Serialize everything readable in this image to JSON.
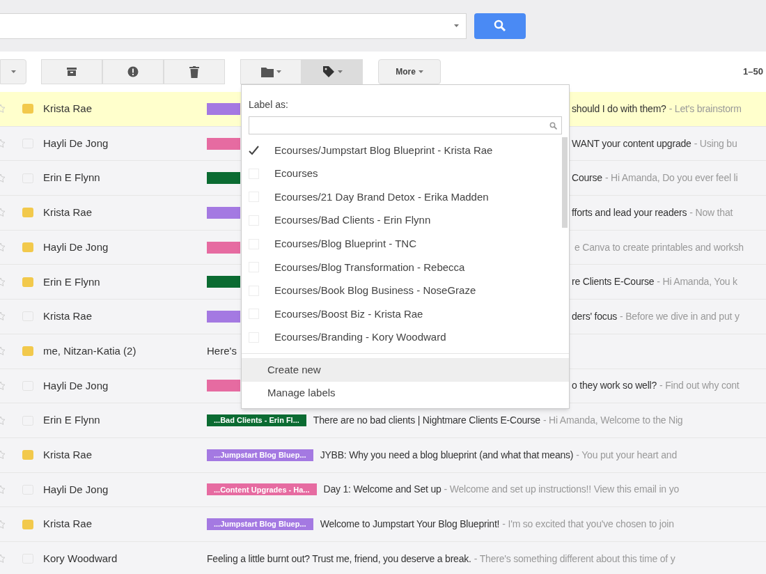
{
  "toolbar": {
    "groups": [
      {
        "buttons": [
          {
            "kind": "caret"
          }
        ]
      },
      {
        "buttons": [
          {
            "kind": "archive"
          },
          {
            "kind": "spam"
          },
          {
            "kind": "delete"
          }
        ]
      },
      {
        "buttons": [
          {
            "kind": "folder",
            "pressed": false
          },
          {
            "kind": "label",
            "pressed": true
          }
        ]
      },
      {
        "buttons": [
          {
            "kind": "more",
            "label": "More"
          }
        ]
      }
    ],
    "range": "1–50"
  },
  "label_menu": {
    "title": "Label as:",
    "items": [
      {
        "label": "Ecourses/Jumpstart Blog Blueprint - Krista Rae",
        "checked": true
      },
      {
        "label": "Ecourses",
        "checked": false
      },
      {
        "label": "Ecourses/21 Day Brand Detox - Erika Madden",
        "checked": false
      },
      {
        "label": "Ecourses/Bad Clients - Erin Flynn",
        "checked": false
      },
      {
        "label": "Ecourses/Blog Blueprint - TNC",
        "checked": false
      },
      {
        "label": "Ecourses/Blog Transformation - Rebecca",
        "checked": false
      },
      {
        "label": "Ecourses/Book Blog Business - NoseGraze",
        "checked": false
      },
      {
        "label": "Ecourses/Boost Biz - Krista Rae",
        "checked": false
      },
      {
        "label": "Ecourses/Branding - Kory Woodward",
        "checked": false
      }
    ],
    "actions": [
      {
        "label": "Create new",
        "selected": true
      },
      {
        "label": "Manage labels",
        "selected": false
      }
    ]
  },
  "rows": [
    {
      "sender": "Krista Rae",
      "important": true,
      "selected": true,
      "covered": true,
      "tag": {
        "color": "#a479e2"
      },
      "subject": "should I do with them?",
      "snippet": "- Let's brainstorm"
    },
    {
      "sender": "Hayli De Jong",
      "important": false,
      "selected": false,
      "covered": true,
      "tag": {
        "color": "#e66ba1"
      },
      "subject": "WANT your content upgrade",
      "snippet": "- Using bu"
    },
    {
      "sender": "Erin E Flynn",
      "important": false,
      "selected": false,
      "covered": true,
      "tag": {
        "color": "#0b6b32"
      },
      "subject": "Course",
      "snippet": "- Hi Amanda, Do you ever feel li"
    },
    {
      "sender": "Krista Rae",
      "important": true,
      "selected": false,
      "covered": true,
      "tag": {
        "color": "#a479e2"
      },
      "subject": "fforts and lead your readers",
      "snippet": "- Now that"
    },
    {
      "sender": "Hayli De Jong",
      "important": true,
      "selected": false,
      "covered": true,
      "tag": {
        "color": "#e66ba1"
      },
      "snippet": "e Canva to create printables and worksh"
    },
    {
      "sender": "Erin E Flynn",
      "important": true,
      "selected": false,
      "covered": true,
      "tag": {
        "color": "#0b6b32"
      },
      "subject": "re Clients E-Course",
      "snippet": "- Hi Amanda, You k"
    },
    {
      "sender": "Krista Rae",
      "important": false,
      "selected": false,
      "covered": true,
      "tag": {
        "color": "#a479e2"
      },
      "subject": "ders' focus",
      "snippet": "- Before we dive in and put y"
    },
    {
      "sender": "me, Nitzan-Katia (2)",
      "important": true,
      "selected": false,
      "covered": true,
      "before": "Here's"
    },
    {
      "sender": "Hayli De Jong",
      "important": false,
      "selected": false,
      "covered": true,
      "tag": {
        "color": "#e66ba1"
      },
      "subject": "o they work so well?",
      "snippet": "- Find out why cont"
    },
    {
      "sender": "Erin E Flynn",
      "important": false,
      "selected": false,
      "covered": false,
      "tag": {
        "text": "...Bad Clients - Erin Fl...",
        "color": "#0b6b32"
      },
      "subject": "There are no bad clients | Nightmare Clients E-Course",
      "snippet": "- Hi Amanda, Welcome to the Nig"
    },
    {
      "sender": "Krista Rae",
      "important": true,
      "selected": false,
      "covered": false,
      "tag": {
        "text": "...Jumpstart Blog Bluep...",
        "color": "#a479e2"
      },
      "subject": "JYBB: Why you need a blog blueprint (and what that means)",
      "snippet": "- You put your heart and"
    },
    {
      "sender": "Hayli De Jong",
      "important": false,
      "selected": false,
      "covered": false,
      "tag": {
        "text": "...Content Upgrades - Ha...",
        "color": "#e66ba1"
      },
      "subject": "Day 1: Welcome and Set up",
      "snippet": "- Welcome and set up instructions!! View this email in yo"
    },
    {
      "sender": "Krista Rae",
      "important": true,
      "selected": false,
      "covered": false,
      "tag": {
        "text": "...Jumpstart Blog Bluep...",
        "color": "#a479e2"
      },
      "subject": "Welcome to Jumpstart Your Blog Blueprint!",
      "snippet": "- I'm so excited that you've chosen to join"
    },
    {
      "sender": "Kory Woodward",
      "important": false,
      "selected": false,
      "covered": false,
      "subject": "Feeling a little burnt out? Trust me, friend, you deserve a break.",
      "snippet": "- There's something different about this time of y"
    }
  ]
}
